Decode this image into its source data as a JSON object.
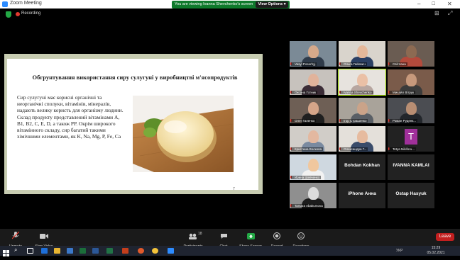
{
  "window": {
    "app_title": "Zoom Meeting",
    "controls": [
      "–",
      "☐",
      "✕"
    ]
  },
  "banner": {
    "text": "You are viewing Ivanna Shevchenko's screen",
    "view_options": "View Options ▾"
  },
  "recording": {
    "label": "Recording"
  },
  "slide": {
    "title": "Обгрунтування використання сиру сулугуні у виробництві м'ясопродуктів",
    "body": "Сир сулугуні має корисні органічні та неорганічні сполуки, вітамінів, мінералів, надають велику користь для організму людини. Склад продукту представлений вітамінами А, В1, В2, С, Е, D, а також РР. Окрім широкого вітамінного складу, сир багатий такими хімічними елементами, як K, Na, Mg, P, Fe, Ca",
    "page_number": "7"
  },
  "participants": [
    {
      "name": "Vasyl Posorhyj"
    },
    {
      "name": "Ольга Гайович"
    },
    {
      "name": "Світлана"
    },
    {
      "name": "Оксана Готник"
    },
    {
      "name": "Ivanna Shevchenko"
    },
    {
      "name": "Михайл Вітрук"
    },
    {
      "name": "Олег Галенко"
    },
    {
      "name": "Ігор Страшенко"
    },
    {
      "name": "Роман Руденк..."
    },
    {
      "name": "Кристина Волкова"
    },
    {
      "name": "Олександра Г..."
    },
    {
      "name": "Tetya Nikiforu...",
      "initial": "T"
    },
    {
      "name": "Ирина Шевченко"
    },
    {
      "name": "Bohdan Kokhan"
    },
    {
      "name": "IVANNA KAMLAI"
    },
    {
      "name": "Tamara Abakumova"
    },
    {
      "name": "iPhone Анна"
    },
    {
      "name": "Ostap Hasyuk"
    }
  ],
  "toolbar": {
    "unmute": "Unmute",
    "stop_video": "Stop Video",
    "participants": "Participants",
    "participants_count": "18",
    "chat": "Chat",
    "share_screen": "Share Screen",
    "record": "Record",
    "reactions": "Reactions",
    "leave": "Leave"
  },
  "taskbar": {
    "time": "15:29",
    "date": "05.02.2021",
    "lang": "УКР"
  },
  "colors": {
    "share_green": "#23a845",
    "leave_red": "#c21f1f",
    "banner_green": "#0f7a2c"
  }
}
